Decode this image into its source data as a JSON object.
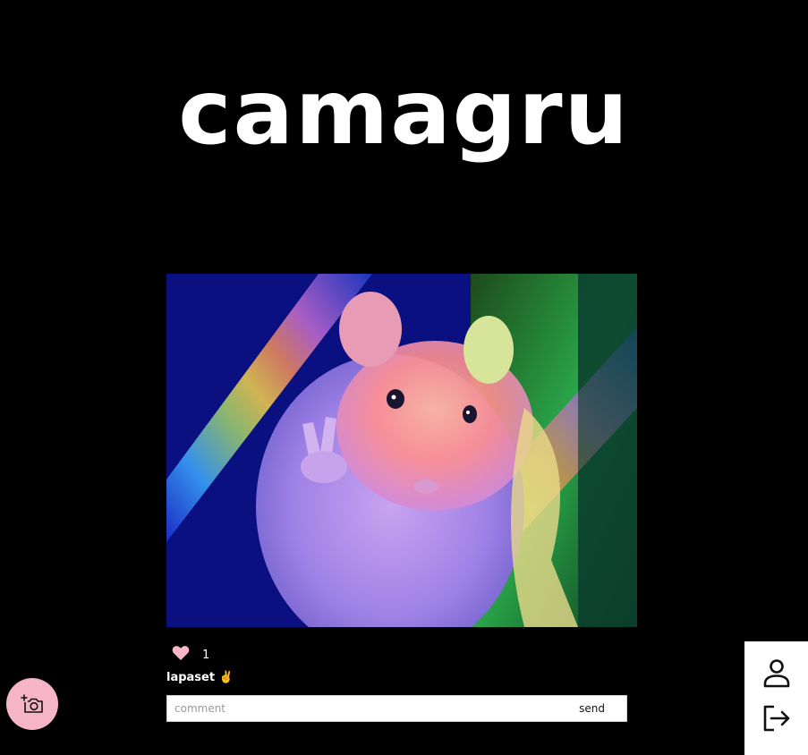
{
  "header": {
    "logo_text": "camagru"
  },
  "post": {
    "image_alt": "hamster photo with rainbow filter",
    "likes": {
      "icon": "heart-icon",
      "count": "1",
      "heart_color": "#f8b4c8"
    },
    "caption": "lapaset ✌️",
    "comment_form": {
      "placeholder": "comment",
      "value": "",
      "send_label": "send"
    }
  },
  "fab": {
    "icon": "add-photo-camera-icon",
    "background": "#f6b5c6"
  },
  "side_menu": {
    "items": [
      {
        "icon": "profile-icon"
      },
      {
        "icon": "logout-icon"
      }
    ]
  },
  "colors": {
    "background": "#000000",
    "text": "#ffffff",
    "accent_pink": "#f6b5c6"
  }
}
